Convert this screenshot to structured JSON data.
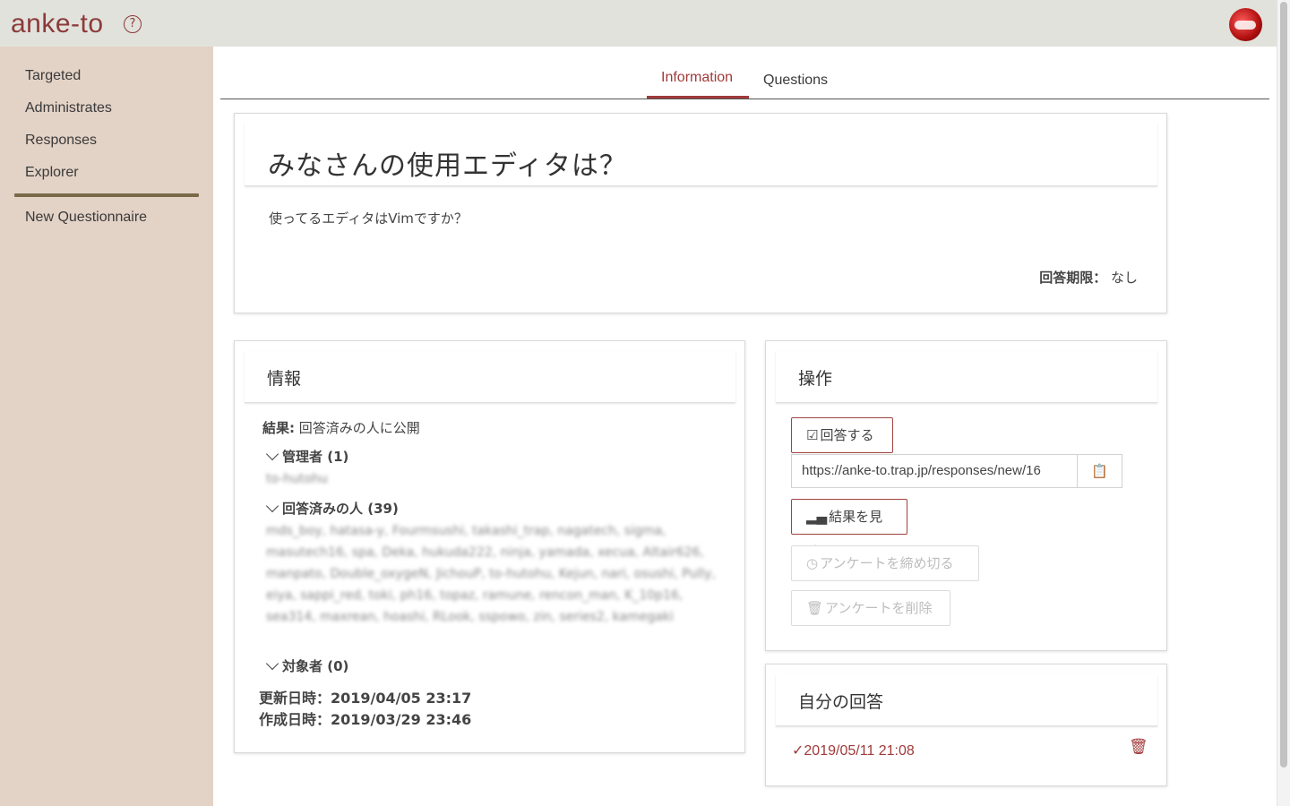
{
  "app": {
    "logo": "anke-to",
    "help_icon": "help-circle-icon"
  },
  "sidebar": {
    "items": [
      {
        "label": "Targeted"
      },
      {
        "label": "Administrates"
      },
      {
        "label": "Responses"
      },
      {
        "label": "Explorer"
      }
    ],
    "new_questionnaire": "New Questionnaire"
  },
  "tabs": [
    {
      "label": "Information",
      "active": true
    },
    {
      "label": "Questions",
      "active": false
    }
  ],
  "questionnaire": {
    "title": "みなさんの使用エディタは？",
    "description": "使ってるエディタはVimですか？",
    "deadline_label": "回答期限：",
    "deadline_value": "なし"
  },
  "info": {
    "header": "情報",
    "results_label": "結果:",
    "results_value": "回答済みの人に公開",
    "admins_label": "管理者 (1)",
    "admins_list": "to-hutohu",
    "responders_label": "回答済みの人 (39)",
    "responders_list": "mds_boy, hatasa-y, Fourmsushi, takashi_trap, nagatech, sigma, masutech16, spa, Deka, hukuda222, ninja, yamada, xecua, Altair626, manpato, Double_oxygeN, JichouP, to-hutohu, Kejun, nari, osushi, Pully, eiya, sappi_red, toki, ph16, topaz, ramune, rencon_man, K_10p16, sea314, maxrean, hoashi, RLook, sspowo, zin, series2, kamegaki",
    "targets_label": "対象者 (0)",
    "updated": "更新日時：2019/04/05 23:17",
    "created": "作成日時：2019/03/29 23:46"
  },
  "operations": {
    "header": "操作",
    "answer_button": "回答する",
    "url": "https://anke-to.trap.jp/responses/new/16",
    "results_button": "結果を見る",
    "close_button": "アンケートを締め切る",
    "delete_button": "アンケートを削除"
  },
  "my_response": {
    "header": "自分の回答",
    "date": "2019/05/11 21:08"
  },
  "colors": {
    "accent": "#a03a3a",
    "sidebar": "#e3d2c6",
    "topbar": "#e1e2dc"
  }
}
